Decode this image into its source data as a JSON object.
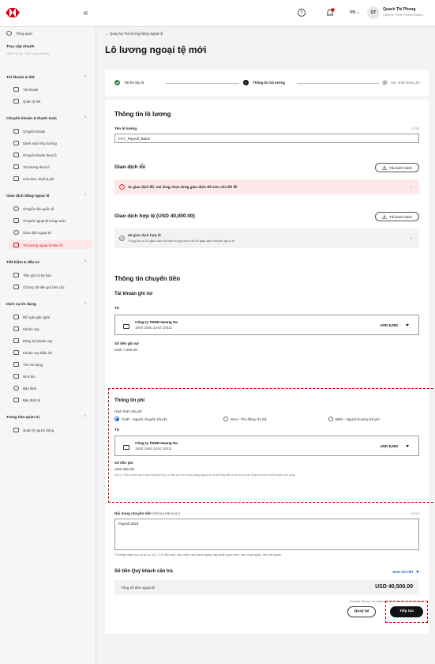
{
  "header": {
    "lang": "VN",
    "avatar_initials": "QT",
    "user_name": "Quach Thi Phung",
    "user_company": "Công ty TNHH Green Beach..."
  },
  "sidebar": {
    "overview": "Tổng quan",
    "quick_access_title": "Truy cập nhanh",
    "quick_access_hint": "Ghim tối đa 7 tính năng tại đây",
    "groups": [
      {
        "title": "Tài khoản & thẻ",
        "items": [
          "Tài khoản",
          "Quản lý thẻ"
        ]
      },
      {
        "title": "Chuyển khoản & thanh toán",
        "items": [
          "Chuyển khoản",
          "Danh sách thụ hưởng",
          "Chuyển khoản theo lô",
          "Trả lương theo lô",
          "Hóa đơn, thuế & phí"
        ]
      },
      {
        "title": "Giao dịch bằng ngoại tệ",
        "items": [
          "Chuyển tiền quốc tế",
          "Chuyển ngoại tệ trong nước",
          "Giao dịch ngoại tệ",
          "Trả lương ngoại tệ theo lô"
        ]
      },
      {
        "title": "Tiết kiệm & đầu tư",
        "items": [
          "Tiền gửi có kỳ hạn",
          "Chứng chỉ tiền gửi làm Lộc"
        ]
      },
      {
        "title": "Dịch vụ tín dụng",
        "items": [
          "Đề nghị giải ngân",
          "Khoản vay",
          "Đăng ký khoản vay",
          "Khoản vay thấu chi",
          "Thư tín dụng",
          "Nhờ thu",
          "Bảo lãnh",
          "Bảo lãnh tệ"
        ]
      },
      {
        "title": "Trung tâm quản trị",
        "items": [
          "Quản lý người dùng"
        ]
      }
    ]
  },
  "main": {
    "back_link": "Quay lại Trả lương bằng ngoại tệ",
    "page_title": "Lô lương ngoại tệ mới",
    "steps": [
      "Tải lên tệp lô",
      "Thông tin trả lương",
      "Xác nhận thông tin"
    ],
    "step_numbers": [
      "2",
      "3"
    ],
    "batch_info_title": "Thông tin lô lương",
    "batch_name_label": "Tên lô lương",
    "batch_name_value": "FCY_Payroll_Batch",
    "batch_name_counter": "17/35",
    "error_tx_title": "Giao dịch lỗi",
    "download_list": "Tải danh sách",
    "error_message": "11 giao dịch lỗi. Vui lòng chọn từng giao dịch để xem chi tiết lỗi",
    "valid_tx_title": "Giao dịch hợp lệ (USD 40,000.00)",
    "valid_count": "49 giao dịch hợp lệ",
    "valid_detail": "Trong đó có 20 giao dịch chuyển trong nước và 29 giao dịch chuyển quốc tế",
    "transfer_info_title": "Thông tin chuyển tiền",
    "debit_account_title": "Tài khoản ghi nợ",
    "from_label": "Từ",
    "company_name": "Công ty TNHH Hoang Ha",
    "account_number": "1900 1560 2240 10011",
    "account_balance": "USD 8,000",
    "debit_amount_label": "Số tiền ghi nợ",
    "debit_amount_value": "USD 7,000.00",
    "fee_info_title": "Thông tin phí",
    "fee_method_label": "Hình thức trả phí",
    "fee_options": [
      "OUR - Người chuyển trả phí",
      "SHA - Phí đồng chi trả",
      "BEN - Người hưởng trả phí"
    ],
    "fee_from_label": "Từ",
    "fee_amount_label": "Số tiền phí",
    "fee_amount_value": "USD 500.00",
    "fee_note": "Lưu ý: Theo chính sách của từng trường, số tiền phí trả lương bằng ngoại tệ có thể thay đổi và sẽ được xác nhận tại bước phê duyệt cuối cùng",
    "content_label": "Nội dung chuyển tiền",
    "content_optional": "(Không bắt buộc)",
    "content_counter": "6/210",
    "content_value": "Payroll 2024",
    "content_hint": "Chỉ nhập nhập mục ký tự a-z, A-Z, 0-9, dấu cách, dấu chấm, dấu gạch ngang, dấu phẩy, gạch chéo, dấu công ngoặc, dấu mở ngoặc.",
    "total_title": "Số tiền Quý khách cần trả",
    "view_detail": "Xem chi tiết",
    "total_label": "Tổng số tiền ngoại tệ",
    "total_value": "USD 40,500.00",
    "terms_note": "Khi nhấn Tiếp tục, chi nhánh giao dịch hiện tài nơi khách hàng...",
    "btn_back": "Quay lại",
    "btn_next": "Tiếp tục"
  },
  "colors": {
    "brand_red": "#db0011",
    "accent_blue": "#1a5dcc",
    "success_green": "#2e8540"
  }
}
